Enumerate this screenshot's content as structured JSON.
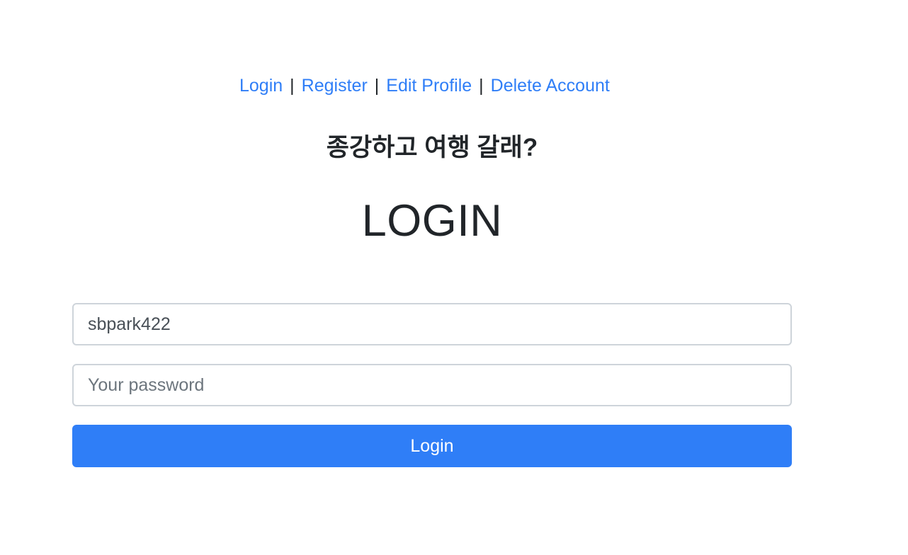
{
  "nav": {
    "links": [
      {
        "label": "Login"
      },
      {
        "label": "Register"
      },
      {
        "label": "Edit Profile"
      },
      {
        "label": "Delete Account"
      }
    ],
    "separator": "|"
  },
  "header": {
    "subtitle": "종강하고 여행 갈래?",
    "title": "LOGIN"
  },
  "form": {
    "username": {
      "value": "sbpark422"
    },
    "password": {
      "value": "",
      "placeholder": "Your password"
    },
    "submit_label": "Login"
  },
  "colors": {
    "accent": "#2f7ef7",
    "text": "#212529",
    "border": "#ced4da"
  }
}
